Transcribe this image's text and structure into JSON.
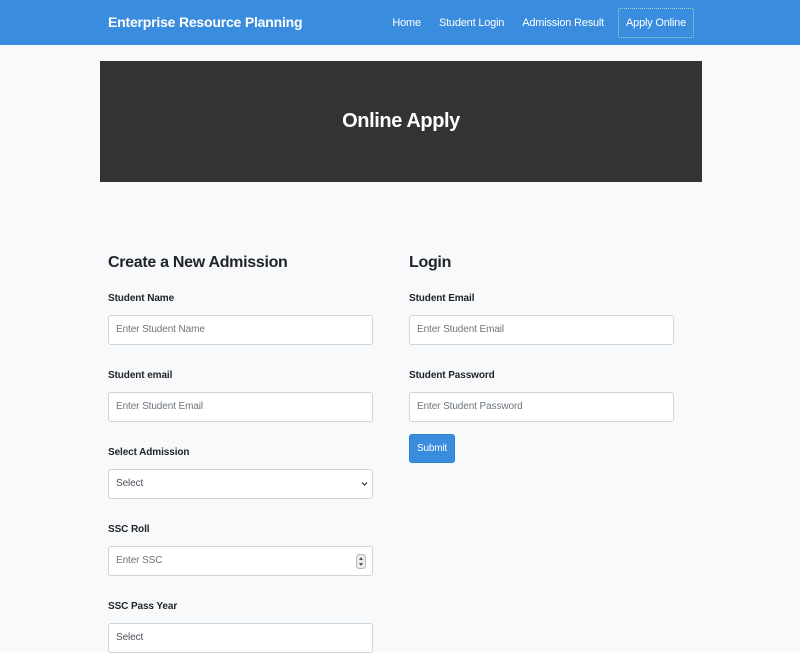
{
  "navbar": {
    "brand": "Enterprise Resource Planning",
    "links": [
      {
        "label": "Home"
      },
      {
        "label": "Student Login"
      },
      {
        "label": "Admission Result"
      },
      {
        "label": "Apply Online",
        "active": true
      }
    ]
  },
  "hero": {
    "title": "Online Apply"
  },
  "admission_form": {
    "title": "Create a New Admission",
    "fields": {
      "name": {
        "label": "Student Name",
        "placeholder": "Enter Student Name"
      },
      "email": {
        "label": "Student email",
        "placeholder": "Enter Student Email"
      },
      "admission": {
        "label": "Select Admission",
        "value": "Select"
      },
      "ssc_roll": {
        "label": "SSC Roll",
        "placeholder": "Enter SSC"
      },
      "ssc_year": {
        "label": "SSC Pass Year",
        "value": "Select"
      }
    }
  },
  "login_form": {
    "title": "Login",
    "fields": {
      "email": {
        "label": "Student Email",
        "placeholder": "Enter Student Email"
      },
      "password": {
        "label": "Student Password",
        "placeholder": "Enter Student Password"
      }
    },
    "submit_label": "Submit"
  },
  "colors": {
    "navbar_bg": "#3a8dde",
    "hero_bg": "#333333",
    "page_bg": "#f8f9fa",
    "button_bg": "#3a8dde"
  },
  "icons": {
    "select_arrow": "chevron-down-icon",
    "number_spinner": "spinner-icon"
  }
}
